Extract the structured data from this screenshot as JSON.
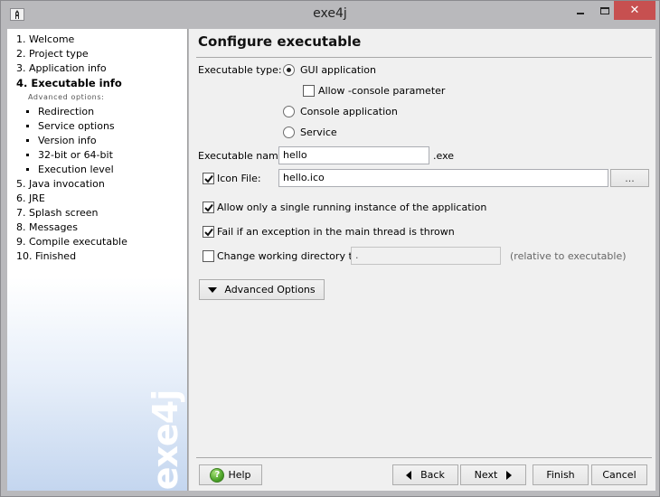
{
  "window": {
    "title": "exe4j",
    "controls": {
      "minimize": "minimize",
      "maximize": "maximize",
      "close": "close"
    },
    "close_color": "#c75050"
  },
  "sidebar": {
    "items": [
      {
        "label": "1. Welcome",
        "active": false
      },
      {
        "label": "2. Project type",
        "active": false
      },
      {
        "label": "3. Application info",
        "active": false
      },
      {
        "label": "4. Executable info",
        "active": true
      }
    ],
    "sub_header": "Advanced options:",
    "sub_items": [
      {
        "label": "Redirection"
      },
      {
        "label": "Service options"
      },
      {
        "label": "Version info"
      },
      {
        "label": "32-bit or 64-bit"
      },
      {
        "label": "Execution level"
      }
    ],
    "items_after": [
      {
        "label": "5. Java invocation"
      },
      {
        "label": "6. JRE"
      },
      {
        "label": "7. Splash screen"
      },
      {
        "label": "8. Messages"
      },
      {
        "label": "9. Compile executable"
      },
      {
        "label": "10. Finished"
      }
    ],
    "logo_text": "exe4j"
  },
  "main": {
    "title": "Configure executable",
    "executable_type": {
      "label": "Executable type:",
      "options": [
        {
          "label": "GUI application",
          "selected": true
        },
        {
          "label": "Console application",
          "selected": false
        },
        {
          "label": "Service",
          "selected": false
        }
      ],
      "allow_console": {
        "label": "Allow -console parameter",
        "checked": false
      }
    },
    "executable_name": {
      "label": "Executable name:",
      "value": "hello",
      "suffix": ".exe"
    },
    "icon_file": {
      "label": "Icon File:",
      "checked": true,
      "value": "hello.ico",
      "browse_label": "..."
    },
    "single_instance": {
      "label": "Allow only a single running instance of the application",
      "checked": true
    },
    "fail_on_exception": {
      "label": "Fail if an exception in the main thread is thrown",
      "checked": true
    },
    "working_dir": {
      "label": "Change working directory to:",
      "checked": false,
      "value": ".",
      "hint": "(relative to executable)"
    },
    "advanced_options_label": "Advanced Options"
  },
  "footer": {
    "help": "Help",
    "back": "Back",
    "next": "Next",
    "finish": "Finish",
    "cancel": "Cancel"
  }
}
